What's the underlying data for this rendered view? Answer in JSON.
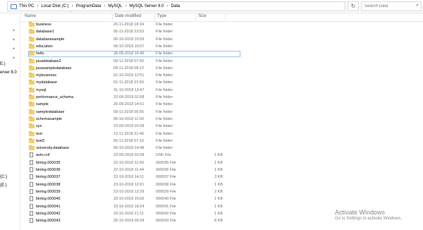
{
  "address_bar": {
    "crumbs": [
      "This PC",
      "Local Disk (C:)",
      "ProgramData",
      "MySQL",
      "MySQL Server 8.0",
      "Data"
    ],
    "separator": "›",
    "refresh_icon": "↻",
    "search_placeholder": "Search Data",
    "search_icon": "⌕"
  },
  "sidebar": {
    "labels": [
      "E:)",
      "erver 8.0",
      "(C:)",
      "(E:)"
    ]
  },
  "columns": {
    "name": "Name",
    "date": "Date modified",
    "type": "Type",
    "size": "Size"
  },
  "files": [
    {
      "name": "business",
      "date": "20-11-2018 18:34",
      "type": "File folder",
      "size": "",
      "kind": "folder"
    },
    {
      "name": "database1",
      "date": "05-11-2018 23:53",
      "type": "File folder",
      "size": "",
      "kind": "folder"
    },
    {
      "name": "databasesample",
      "date": "06-10-2018 10:59",
      "type": "File folder",
      "size": "",
      "kind": "folder"
    },
    {
      "name": "education",
      "date": "06-10-2018 15:07",
      "type": "File folder",
      "size": "",
      "kind": "folder"
    },
    {
      "name": "hello",
      "date": "28-09-2018 16:46",
      "type": "File folder",
      "size": "",
      "kind": "folder",
      "selected": true
    },
    {
      "name": "javadatabase2",
      "date": "09-11-2018 07:50",
      "type": "File folder",
      "size": "",
      "kind": "folder"
    },
    {
      "name": "javasampledatabase",
      "date": "09-11-2018 08:12",
      "type": "File folder",
      "size": "",
      "kind": "folder"
    },
    {
      "name": "mybusiness",
      "date": "01-10-2018 12:51",
      "type": "File folder",
      "size": "",
      "kind": "folder"
    },
    {
      "name": "mydatabase",
      "date": "01-11-2018 22:56",
      "type": "File folder",
      "size": "",
      "kind": "folder"
    },
    {
      "name": "mysql",
      "date": "31-10-2018 13:47",
      "type": "File folder",
      "size": "",
      "kind": "folder"
    },
    {
      "name": "performance_schema",
      "date": "23-09-2018 02:08",
      "type": "File folder",
      "size": "",
      "kind": "folder"
    },
    {
      "name": "sample",
      "date": "26-09-2018 14:51",
      "type": "File folder",
      "size": "",
      "kind": "folder"
    },
    {
      "name": "sampledatabase",
      "date": "09-11-2018 06:55",
      "type": "File folder",
      "size": "",
      "kind": "folder"
    },
    {
      "name": "schemasample",
      "date": "06-10-2018 11:00",
      "type": "File folder",
      "size": "",
      "kind": "folder"
    },
    {
      "name": "sys",
      "date": "23-09-2018 02:08",
      "type": "File folder",
      "size": "",
      "kind": "folder"
    },
    {
      "name": "test",
      "date": "12-11-2018 21:46",
      "type": "File folder",
      "size": "",
      "kind": "folder"
    },
    {
      "name": "test3",
      "date": "05-11-2018 07:16",
      "type": "File folder",
      "size": "",
      "kind": "folder"
    },
    {
      "name": "university.database",
      "date": "06-10-2018 14:48",
      "type": "File folder",
      "size": "",
      "kind": "folder"
    },
    {
      "name": "auto.cnf",
      "date": "23-09-2018 02:08",
      "type": "CNF File",
      "size": "1 KB",
      "kind": "file"
    },
    {
      "name": "binlog.000035",
      "date": "22-10-2018 11:43",
      "type": "000035 File",
      "size": "1 KB",
      "kind": "file"
    },
    {
      "name": "binlog.000036",
      "date": "22-10-2018 11:44",
      "type": "000036 File",
      "size": "1 KB",
      "kind": "file"
    },
    {
      "name": "binlog.000037",
      "date": "22-10-2018 14:11",
      "type": "000037 File",
      "size": "3 KB",
      "kind": "file"
    },
    {
      "name": "binlog.000038",
      "date": "23-10-2018 12:01",
      "type": "000038 File",
      "size": "1 KB",
      "kind": "file"
    },
    {
      "name": "binlog.000039",
      "date": "23-10-2018 12:29",
      "type": "000039 File",
      "size": "2 KB",
      "kind": "file"
    },
    {
      "name": "binlog.000040",
      "date": "23-10-2018 15:06",
      "type": "000040 File",
      "size": "1 KB",
      "kind": "file"
    },
    {
      "name": "binlog.000041",
      "date": "23-10-2018 18:24",
      "type": "000041 File",
      "size": "1 KB",
      "kind": "file"
    },
    {
      "name": "binlog.000042",
      "date": "23-10-2018 21:11",
      "type": "000042 File",
      "size": "1 KB",
      "kind": "file"
    },
    {
      "name": "binlog.000043",
      "date": "25-10-2018 09:34",
      "type": "000043 File",
      "size": "8 KB",
      "kind": "file"
    }
  ],
  "watermark": {
    "title": "Activate Windows",
    "subtitle": "Go to Settings to activate Windows."
  }
}
